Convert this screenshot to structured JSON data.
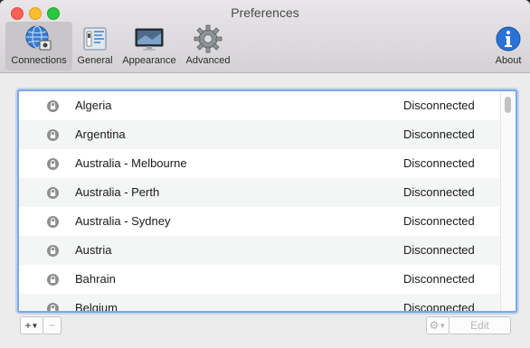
{
  "window": {
    "title": "Preferences"
  },
  "toolbar": {
    "items": [
      {
        "label": "Connections",
        "icon": "globe-network-icon",
        "selected": true
      },
      {
        "label": "General",
        "icon": "switch-panel-icon",
        "selected": false
      },
      {
        "label": "Appearance",
        "icon": "monitor-icon",
        "selected": false
      },
      {
        "label": "Advanced",
        "icon": "gear-icon",
        "selected": false
      }
    ],
    "about": {
      "label": "About",
      "icon": "info-icon"
    }
  },
  "connections": [
    {
      "country": "Algeria",
      "status": "Disconnected"
    },
    {
      "country": "Argentina",
      "status": "Disconnected"
    },
    {
      "country": "Australia - Melbourne",
      "status": "Disconnected"
    },
    {
      "country": "Australia - Perth",
      "status": "Disconnected"
    },
    {
      "country": "Australia - Sydney",
      "status": "Disconnected"
    },
    {
      "country": "Austria",
      "status": "Disconnected"
    },
    {
      "country": "Bahrain",
      "status": "Disconnected"
    },
    {
      "country": "Belgium",
      "status": "Disconnected"
    }
  ],
  "bottom_bar": {
    "add_label": "+",
    "remove_label": "−",
    "action_icon": "gear-icon",
    "edit_label": "Edit"
  },
  "colors": {
    "focus_ring": "#79a9e8",
    "accent": "#1f6fd6"
  }
}
